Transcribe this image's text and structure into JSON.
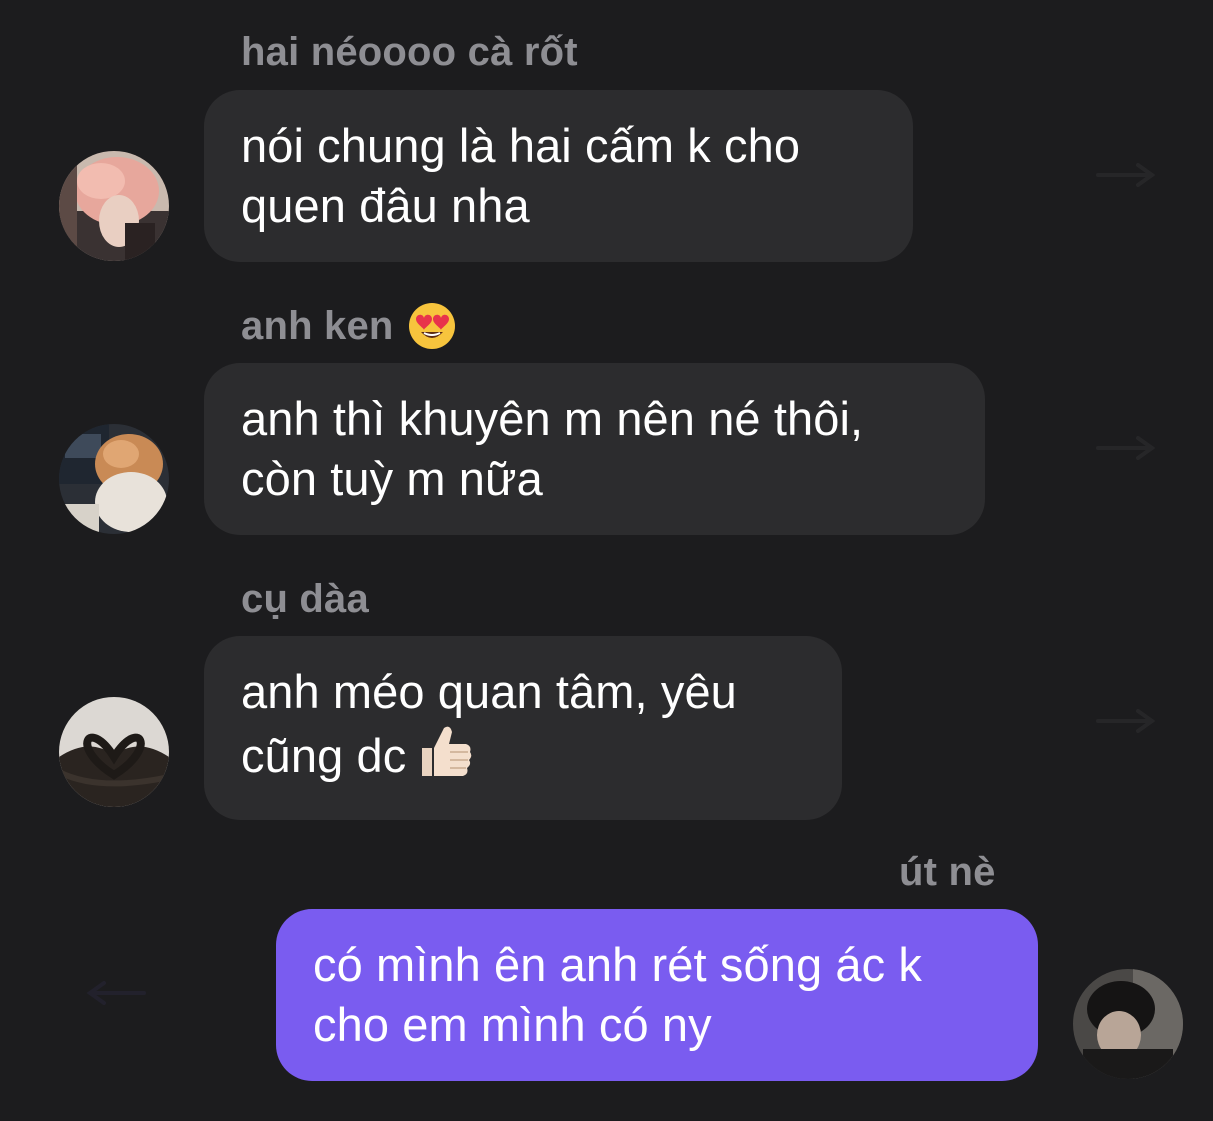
{
  "messages": [
    {
      "sender": "hai néoooo cà rốt",
      "lines": [
        "nói chung là hai cấm k cho",
        "quen đâu nha"
      ],
      "avatar": "avatar-pink-hair"
    },
    {
      "sender": "anh ken",
      "sender_emoji": "heart-eyes-emoji",
      "lines": [
        "anh thì khuyên m nên né thôi,",
        "còn tuỳ m nữa"
      ],
      "avatar": "avatar-curly-hair"
    },
    {
      "sender": "cụ dàa",
      "lines": [
        "anh méo quan tâm, yêu",
        "cũng dc"
      ],
      "line_emoji": "thumbs-up-emoji",
      "avatar": "avatar-heart-hair"
    },
    {
      "sender": "út nè",
      "lines": [
        "có mình ên anh rét sống ác k",
        "cho em mình có ny"
      ],
      "avatar": "avatar-dark-hair",
      "mine": true
    }
  ],
  "colors": {
    "background": "#1c1c1e",
    "incoming_bubble": "#2c2c2e",
    "outgoing_bubble": "#7a5cf0",
    "sender_name": "#8e8e93",
    "text": "#ffffff"
  }
}
